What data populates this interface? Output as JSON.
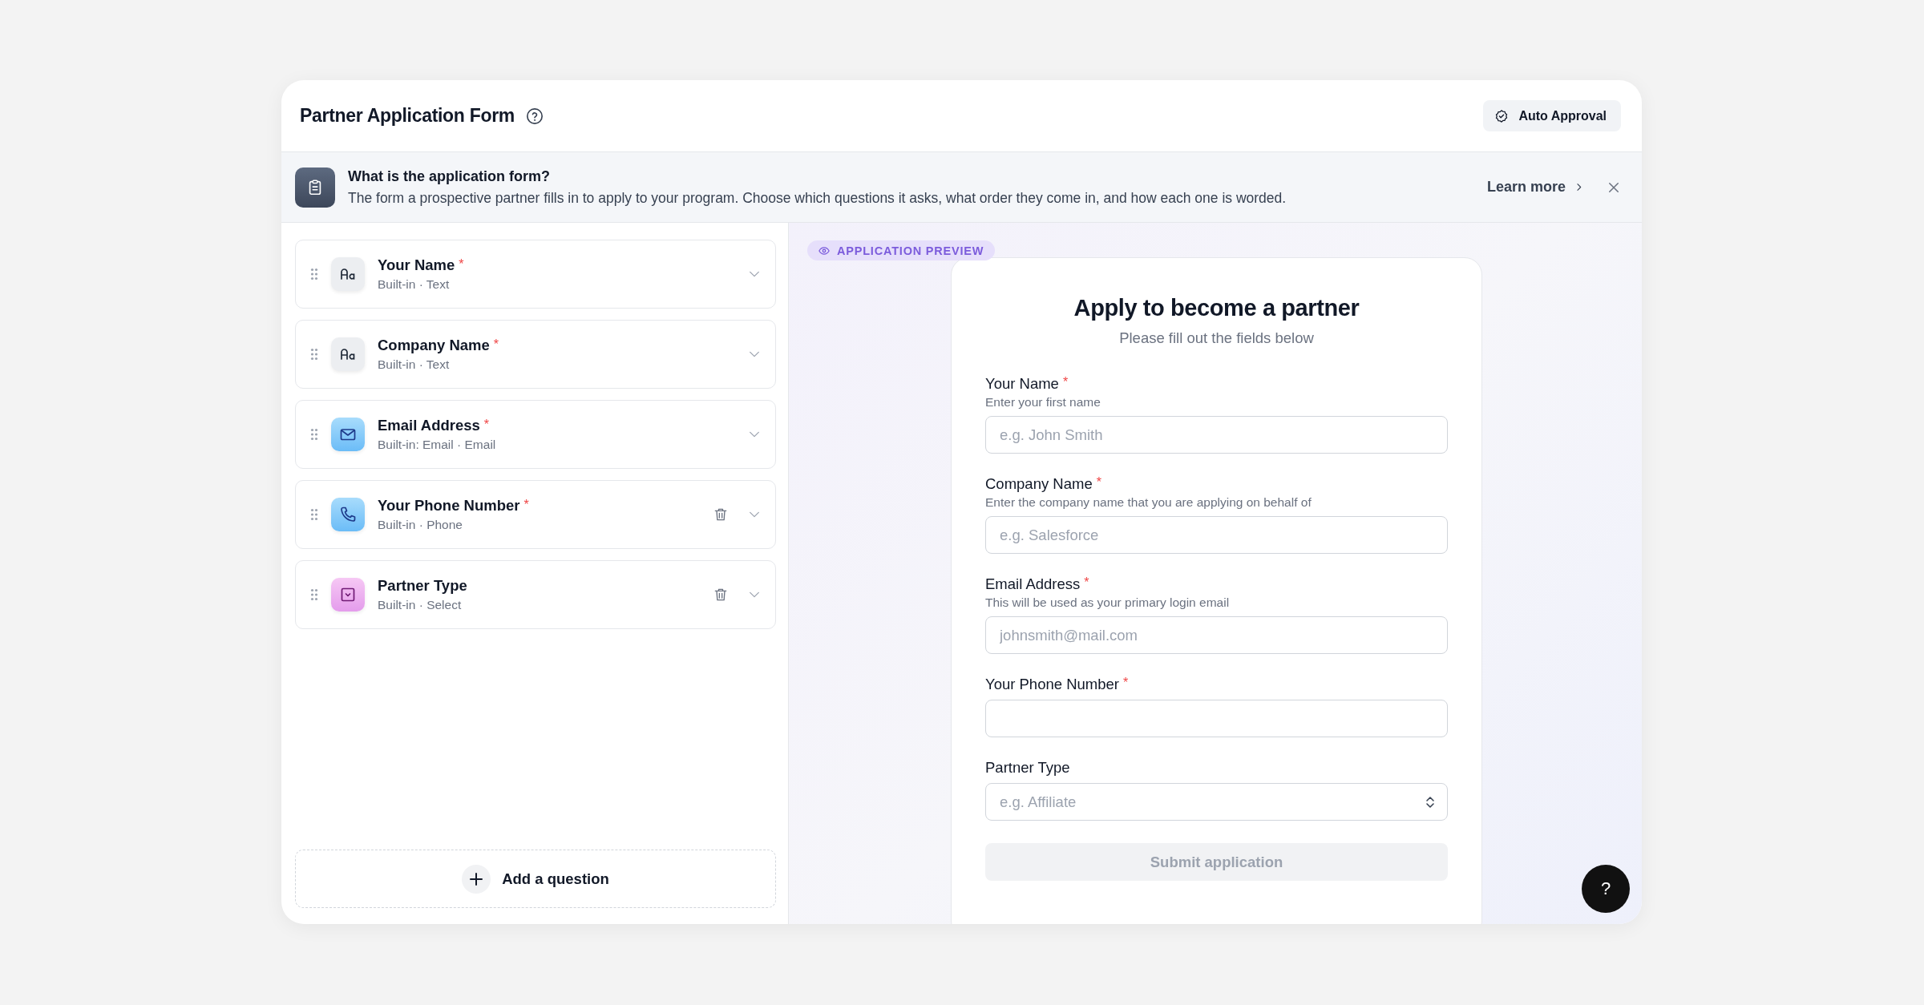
{
  "window": {
    "title": "Partner Application Form",
    "header_button": "Auto Approval"
  },
  "info_banner": {
    "title": "What is the application form?",
    "description": "The form a prospective partner fills in to apply to your program. Choose which questions it asks, what order they come in, and how each one is worded.",
    "link": "Learn more"
  },
  "questions": [
    {
      "title": "Your Name",
      "required_mark": "*",
      "subtitle": "Built-in · Text",
      "kind": "text",
      "deletable": false
    },
    {
      "title": "Company Name",
      "required_mark": "*",
      "subtitle": "Built-in · Text",
      "kind": "text",
      "deletable": false
    },
    {
      "title": "Email Address",
      "required_mark": "*",
      "subtitle": "Built-in: Email · Email",
      "kind": "email",
      "deletable": false
    },
    {
      "title": "Your Phone Number",
      "required_mark": "*",
      "subtitle": "Built-in · Phone",
      "kind": "phone",
      "deletable": true
    },
    {
      "title": "Partner Type",
      "subtitle": "Built-in · Select",
      "kind": "select",
      "deletable": true
    }
  ],
  "add_question": "Add a question",
  "preview": {
    "badge": "APPLICATION PREVIEW",
    "heading": "Apply to become a partner",
    "subheading": "Please fill out the fields below",
    "fields": [
      {
        "label": "Your Name",
        "required_mark": "*",
        "hint": "Enter your first name",
        "placeholder": "e.g. John Smith",
        "kind": "text"
      },
      {
        "label": "Company Name",
        "required_mark": "*",
        "hint": "Enter the company name that you are applying on behalf of",
        "placeholder": "e.g. Salesforce",
        "kind": "text"
      },
      {
        "label": "Email Address",
        "required_mark": "*",
        "hint": "This will be used as your primary login email",
        "placeholder": "johnsmith@mail.com",
        "kind": "text"
      },
      {
        "label": "Your Phone Number",
        "required_mark": "*",
        "kind": "text"
      },
      {
        "label": "Partner Type",
        "placeholder": "e.g. Affiliate",
        "kind": "select"
      }
    ],
    "submit": "Submit application",
    "submit_disabled": true
  },
  "help_button": "?"
}
